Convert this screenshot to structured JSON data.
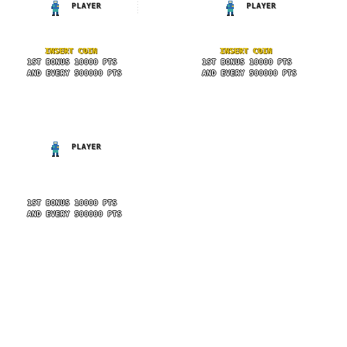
{
  "screens": [
    {
      "player_label": "PLAYER",
      "insert_coin": "INSERT COIN",
      "bonus_line1": "1ST BONUS 10000 PTS",
      "bonus_line2": "AND EVERY 500000 PTS"
    },
    {
      "player_label": "PLAYER",
      "insert_coin": "INSERT COIN",
      "bonus_line1": "1ST BONUS 10000 PTS",
      "bonus_line2": "AND EVERY 500000 PTS"
    },
    {
      "player_label": "PLAYER",
      "insert_coin": "",
      "bonus_line1": "1ST BONUS 10000 PTS",
      "bonus_line2": "AND EVERY 500000 PTS"
    }
  ],
  "colors": {
    "background": "#ffffff",
    "insert_coin": "#f2d21e",
    "sprite_blue": "#2f6fb0",
    "sprite_teal": "#3aa8a0"
  },
  "icons": {
    "sprite": "player-sprite-icon"
  }
}
